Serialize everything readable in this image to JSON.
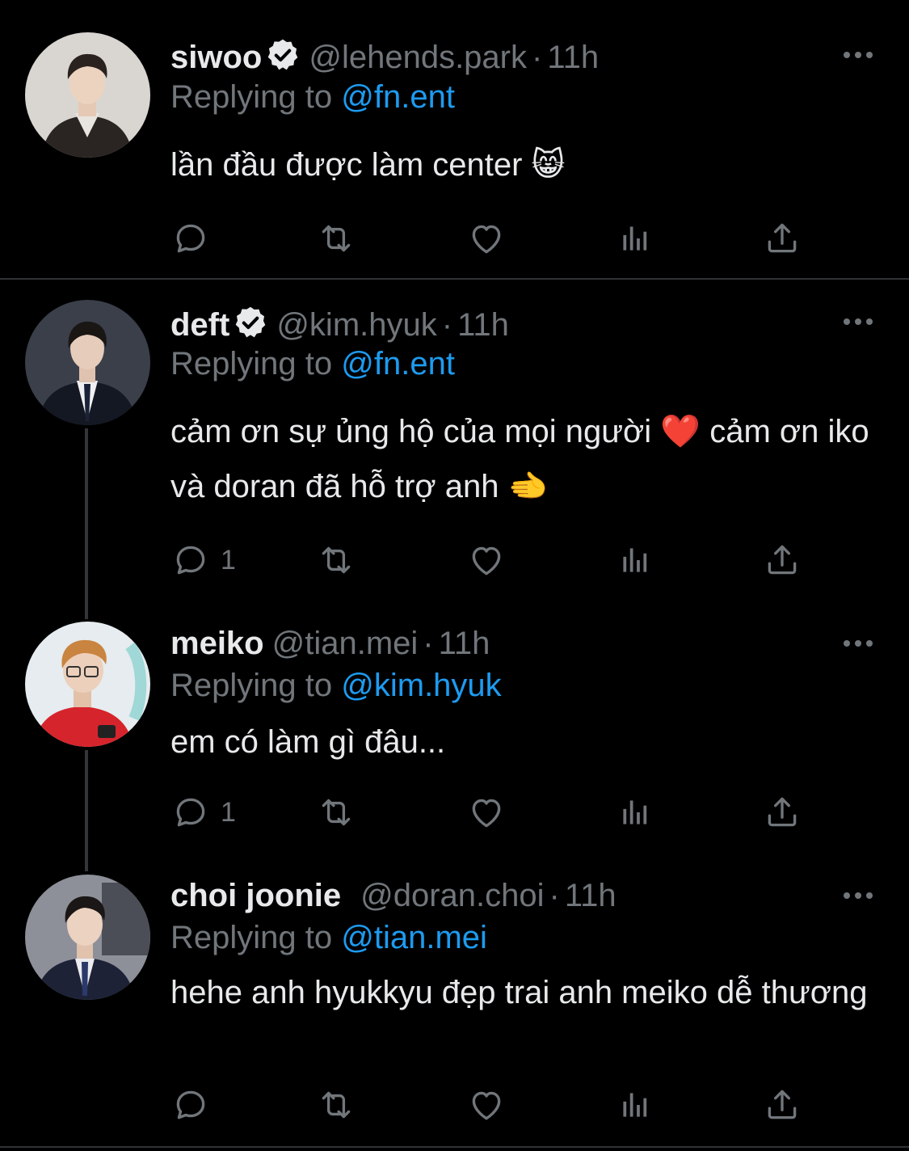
{
  "tweets": [
    {
      "name": "siwoo",
      "verified": true,
      "handle": "@lehends.park",
      "dot": "·",
      "time": "11h",
      "replying_prefix": "Replying to",
      "replying_to": "@fn.ent",
      "text": "lần đầu được làm center 😸",
      "reply_count": ""
    },
    {
      "name": "deft",
      "verified": true,
      "handle": "@kim.hyuk",
      "dot": "·",
      "time": "11h",
      "replying_prefix": "Replying to",
      "replying_to": "@fn.ent",
      "text": "cảm ơn sự ủng hộ của mọi người ❤️  cảm ơn iko và doran đã hỗ trợ anh 🫲",
      "reply_count": "1"
    },
    {
      "name": "meiko",
      "verified": false,
      "handle": "@tian.mei",
      "dot": "·",
      "time": "11h",
      "replying_prefix": "Replying to",
      "replying_to": "@kim.hyuk",
      "text": "em có làm gì đâu...",
      "reply_count": "1"
    },
    {
      "name": "choi joonie",
      "verified": false,
      "handle": "@doran.choi",
      "dot": "·",
      "time": "11h",
      "replying_prefix": "Replying to",
      "replying_to": "@tian.mei",
      "text": "hehe anh hyukkyu đẹp trai anh meiko dễ thương",
      "reply_count": ""
    }
  ],
  "icons": {
    "reply": "reply-icon",
    "retweet": "retweet-icon",
    "like": "heart-icon",
    "views": "views-icon",
    "share": "share-icon",
    "more": "more-icon",
    "verified": "verified-badge-icon"
  },
  "colors": {
    "background": "#000000",
    "primary_text": "#e7e9ea",
    "secondary_text": "#71767b",
    "link": "#1d9bf0",
    "divider": "#2f3336"
  }
}
